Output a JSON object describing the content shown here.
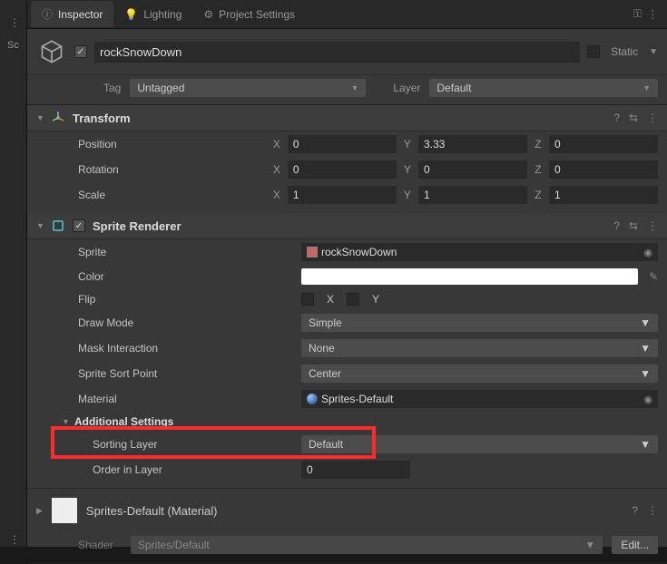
{
  "tabs": {
    "inspector": "Inspector",
    "lighting": "Lighting",
    "project_settings": "Project Settings"
  },
  "left_sliver": {
    "label": "Sc"
  },
  "header": {
    "name": "rockSnowDown",
    "static_label": "Static",
    "tag_label": "Tag",
    "tag_value": "Untagged",
    "layer_label": "Layer",
    "layer_value": "Default"
  },
  "transform": {
    "title": "Transform",
    "position_label": "Position",
    "rotation_label": "Rotation",
    "scale_label": "Scale",
    "pos": {
      "x": "0",
      "y": "3.33",
      "z": "0"
    },
    "rot": {
      "x": "0",
      "y": "0",
      "z": "0"
    },
    "scale": {
      "x": "1",
      "y": "1",
      "z": "1"
    }
  },
  "sprite_renderer": {
    "title": "Sprite Renderer",
    "sprite_label": "Sprite",
    "sprite_value": "rockSnowDown",
    "color_label": "Color",
    "flip_label": "Flip",
    "flip_x": "X",
    "flip_y": "Y",
    "draw_mode_label": "Draw Mode",
    "draw_mode_value": "Simple",
    "mask_label": "Mask Interaction",
    "mask_value": "None",
    "sort_point_label": "Sprite Sort Point",
    "sort_point_value": "Center",
    "material_label": "Material",
    "material_value": "Sprites-Default",
    "additional_label": "Additional Settings",
    "sorting_layer_label": "Sorting Layer",
    "sorting_layer_value": "Default",
    "order_label": "Order in Layer",
    "order_value": "0"
  },
  "material_section": {
    "title": "Sprites-Default (Material)",
    "shader_label": "Shader",
    "shader_value": "Sprites/Default",
    "edit_label": "Edit..."
  },
  "axis": {
    "x": "X",
    "y": "Y",
    "z": "Z"
  }
}
